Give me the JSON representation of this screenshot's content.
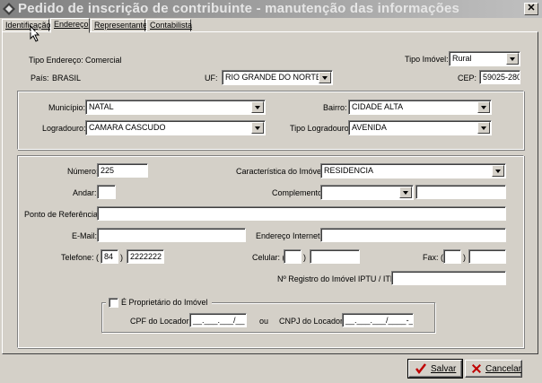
{
  "window": {
    "title": "Pedido de inscrição de contribuinte - manutenção das informações",
    "close_glyph": "✕"
  },
  "tabs": [
    {
      "label": "Identificação",
      "active": false
    },
    {
      "label": "Endereço",
      "active": true
    },
    {
      "label": "Representante",
      "active": false
    },
    {
      "label": "Contabilista",
      "active": false
    }
  ],
  "top": {
    "tipo_endereco_label": "Tipo Endereço:",
    "tipo_endereco_value": "Comercial",
    "tipo_imovel_label": "Tipo Imóvel:",
    "tipo_imovel_value": "Rural",
    "pais_label": "País:",
    "pais_value": "BRASIL",
    "uf_label": "UF:",
    "uf_value": "RIO GRANDE DO NORTE",
    "cep_label": "CEP:",
    "cep_value": "59025-280"
  },
  "location": {
    "municipio_label": "Município:",
    "municipio_value": "NATAL",
    "bairro_label": "Bairro:",
    "bairro_value": "CIDADE ALTA",
    "logradouro_label": "Logradouro:",
    "logradouro_value": "CAMARA CASCUDO",
    "tipo_logradouro_label": "Tipo Logradouro:",
    "tipo_logradouro_value": "AVENIDA"
  },
  "details": {
    "numero_label": "Número:",
    "numero_value": "225",
    "caracteristica_label": "Característica do Imóvel:",
    "caracteristica_value": "RESIDENCIA",
    "andar_label": "Andar:",
    "andar_value": "",
    "complemento_label": "Complemento:",
    "complemento_value": "",
    "complemento_text": "",
    "ponto_referencia_label": "Ponto de Referência:",
    "ponto_referencia_value": "",
    "email_label": "E-Mail:",
    "email_value": "",
    "endereco_internet_label": "Endereço Internet:",
    "endereco_internet_value": "",
    "telefone_label": "Telefone: (",
    "telefone_ddd": "84",
    "telefone_close": ")",
    "telefone_numero": "2222222",
    "celular_label": "Celular: (",
    "celular_ddd": "",
    "celular_close": ")",
    "celular_numero": "",
    "fax_label": "Fax: (",
    "fax_ddd": "",
    "fax_close": ")",
    "fax_numero": "",
    "registro_label": "Nº Registro do Imóvel  IPTU / ITR:",
    "registro_value": ""
  },
  "owner": {
    "checkbox_label": "É Proprietário do Imóvel",
    "checked": false,
    "cpf_label": "CPF do Locador:",
    "cpf_value": "__.___.___/__",
    "ou_label": "ou",
    "cnpj_label": "CNPJ do Locador:",
    "cnpj_value": "__.___.___/____-__"
  },
  "buttons": {
    "salvar": "Salvar",
    "cancelar": "Cancelar"
  },
  "icons": {
    "app": "app-icon",
    "check": "checkmark-icon",
    "cancel": "x-icon",
    "cursor": "mouse-pointer-icon"
  },
  "colors": {
    "face": "#d4d0c8",
    "salvar_icon": "#c00000",
    "cancelar_icon": "#c00000"
  }
}
